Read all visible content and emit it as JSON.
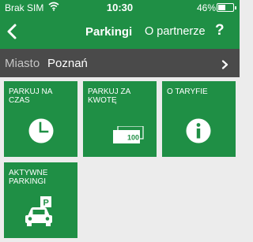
{
  "status_bar": {
    "carrier": "Brak SIM",
    "time": "10:30",
    "battery": "46%",
    "battery_level": 0.46
  },
  "nav": {
    "title": "Parkingi",
    "partner_label": "O partnerze",
    "help": "?"
  },
  "city": {
    "label": "Miasto",
    "value": "Poznań"
  },
  "tiles": [
    {
      "label": "PARKUJ NA CZAS",
      "icon": "clock-icon"
    },
    {
      "label": "PARKUJ ZA KWOTĘ",
      "icon": "banknote-icon",
      "amount": "100"
    },
    {
      "label": "O TARYFIE",
      "icon": "info-icon"
    },
    {
      "label": "AKTYWNE PARKINGI",
      "icon": "car-parking-icon",
      "badge": "P"
    }
  ],
  "colors": {
    "brand_green": "#1f8f45",
    "city_bar": "#4a4a4a",
    "background": "#ececec"
  }
}
